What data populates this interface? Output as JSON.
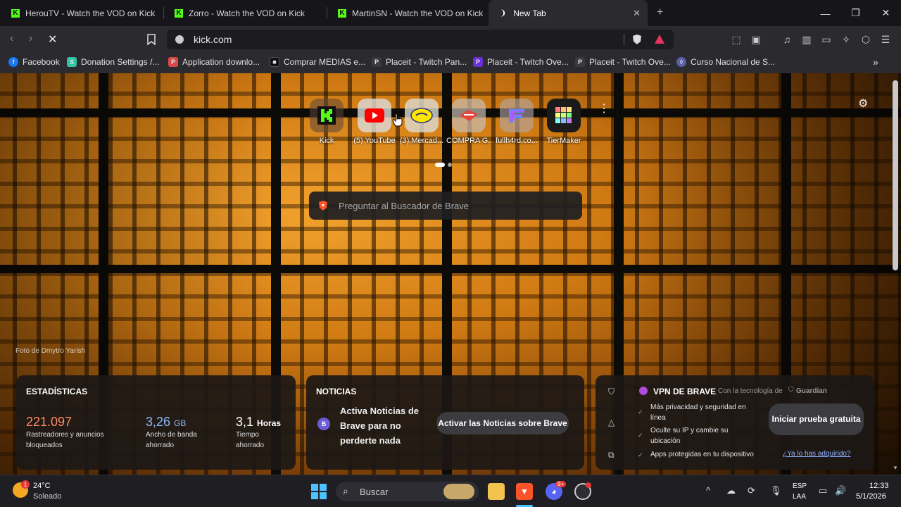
{
  "tabs": [
    {
      "title": "HerouTV - Watch the VOD on Kick",
      "favicon": "kick-icon",
      "active": false
    },
    {
      "title": "Zorro - Watch the VOD on Kick",
      "favicon": "kick-icon",
      "active": false
    },
    {
      "title": "MartinSN - Watch the VOD on Kick",
      "favicon": "kick-icon",
      "active": false
    },
    {
      "title": "New Tab",
      "favicon": "loading-icon",
      "active": true
    }
  ],
  "toolbar": {
    "url": "kick.com"
  },
  "bookmarks": [
    {
      "label": "Facebook",
      "icon": "facebook-icon",
      "color": "#1877f2",
      "glyph": "f"
    },
    {
      "label": "Donation Settings /...",
      "icon": "streamlabs-icon",
      "color": "#31c3a2",
      "glyph": "S"
    },
    {
      "label": "Application downlo...",
      "icon": "pog-icon",
      "color": "#d84a4a",
      "glyph": "P"
    },
    {
      "label": "Comprar MEDIAS e...",
      "icon": "store-icon",
      "color": "#222222",
      "glyph": "■"
    },
    {
      "label": "Placeit - Twitch Pan...",
      "icon": "placeit-icon",
      "color": "#3a3a3f",
      "glyph": "P"
    },
    {
      "label": "Placeit - Twitch Ove...",
      "icon": "placeit-purple-icon",
      "color": "#6b2fd6",
      "glyph": "P"
    },
    {
      "label": "Placeit - Twitch Ove...",
      "icon": "placeit-icon",
      "color": "#3a3a3f",
      "glyph": "P"
    },
    {
      "label": "Curso Nacional de S...",
      "icon": "course-icon",
      "color": "#5b5fa8",
      "glyph": "◊"
    }
  ],
  "top_sites": [
    {
      "label": "Kick",
      "icon": "kick-icon"
    },
    {
      "label": "(5) YouTube",
      "icon": "youtube-icon"
    },
    {
      "label": "(3) Mercad...",
      "icon": "mercadolibre-icon"
    },
    {
      "label": "COMPRA G...",
      "icon": "compra-icon"
    },
    {
      "label": "fullh4rd.co...",
      "icon": "fullh4rd-icon"
    },
    {
      "label": "TierMaker",
      "icon": "tiermaker-icon"
    }
  ],
  "background": {
    "photo_credit": "Foto de Dmytro Yarish"
  },
  "search": {
    "placeholder": "Preguntar al Buscador de Brave"
  },
  "stats": {
    "title": "ESTADÍSTICAS",
    "trackers_value": "221.097",
    "trackers_label": "Rastreadores y anuncios bloqueados",
    "bandwidth_value": "3,26",
    "bandwidth_unit": "GB",
    "bandwidth_label": "Ancho de banda ahorrado",
    "time_value": "3,1",
    "time_unit": "Horas",
    "time_label": "Tiempo ahorrado"
  },
  "news": {
    "title": "NOTICIAS",
    "message": "Activa Noticias de Brave para no perderte nada",
    "button": "Activar las Noticias sobre Brave"
  },
  "vpn": {
    "title": "VPN DE BRAVE",
    "powered_by": "Con la tecnología de",
    "partner": "Guardian",
    "features": [
      "Más privacidad y seguridad en línea",
      "Oculte su IP y cambie su ubicación",
      "Apps protegidas en tu dispositivo"
    ],
    "trial_button": "Iniciar prueba gratuita",
    "already_link": "¿Ya lo has adquirido?"
  },
  "taskbar": {
    "weather_temp": "24°C",
    "weather_desc": "Soleado",
    "weather_badge": "1",
    "search_placeholder": "Buscar",
    "language_top": "ESP",
    "language_bottom": "LAA",
    "time": "12:33",
    "date": "5/1/2026",
    "discord_badge": "9+"
  },
  "colors": {
    "kick_green": "#53fc18",
    "brave_orange": "#fb542b",
    "trackers": "#ff8a65",
    "bandwidth": "#8fb8ff"
  }
}
